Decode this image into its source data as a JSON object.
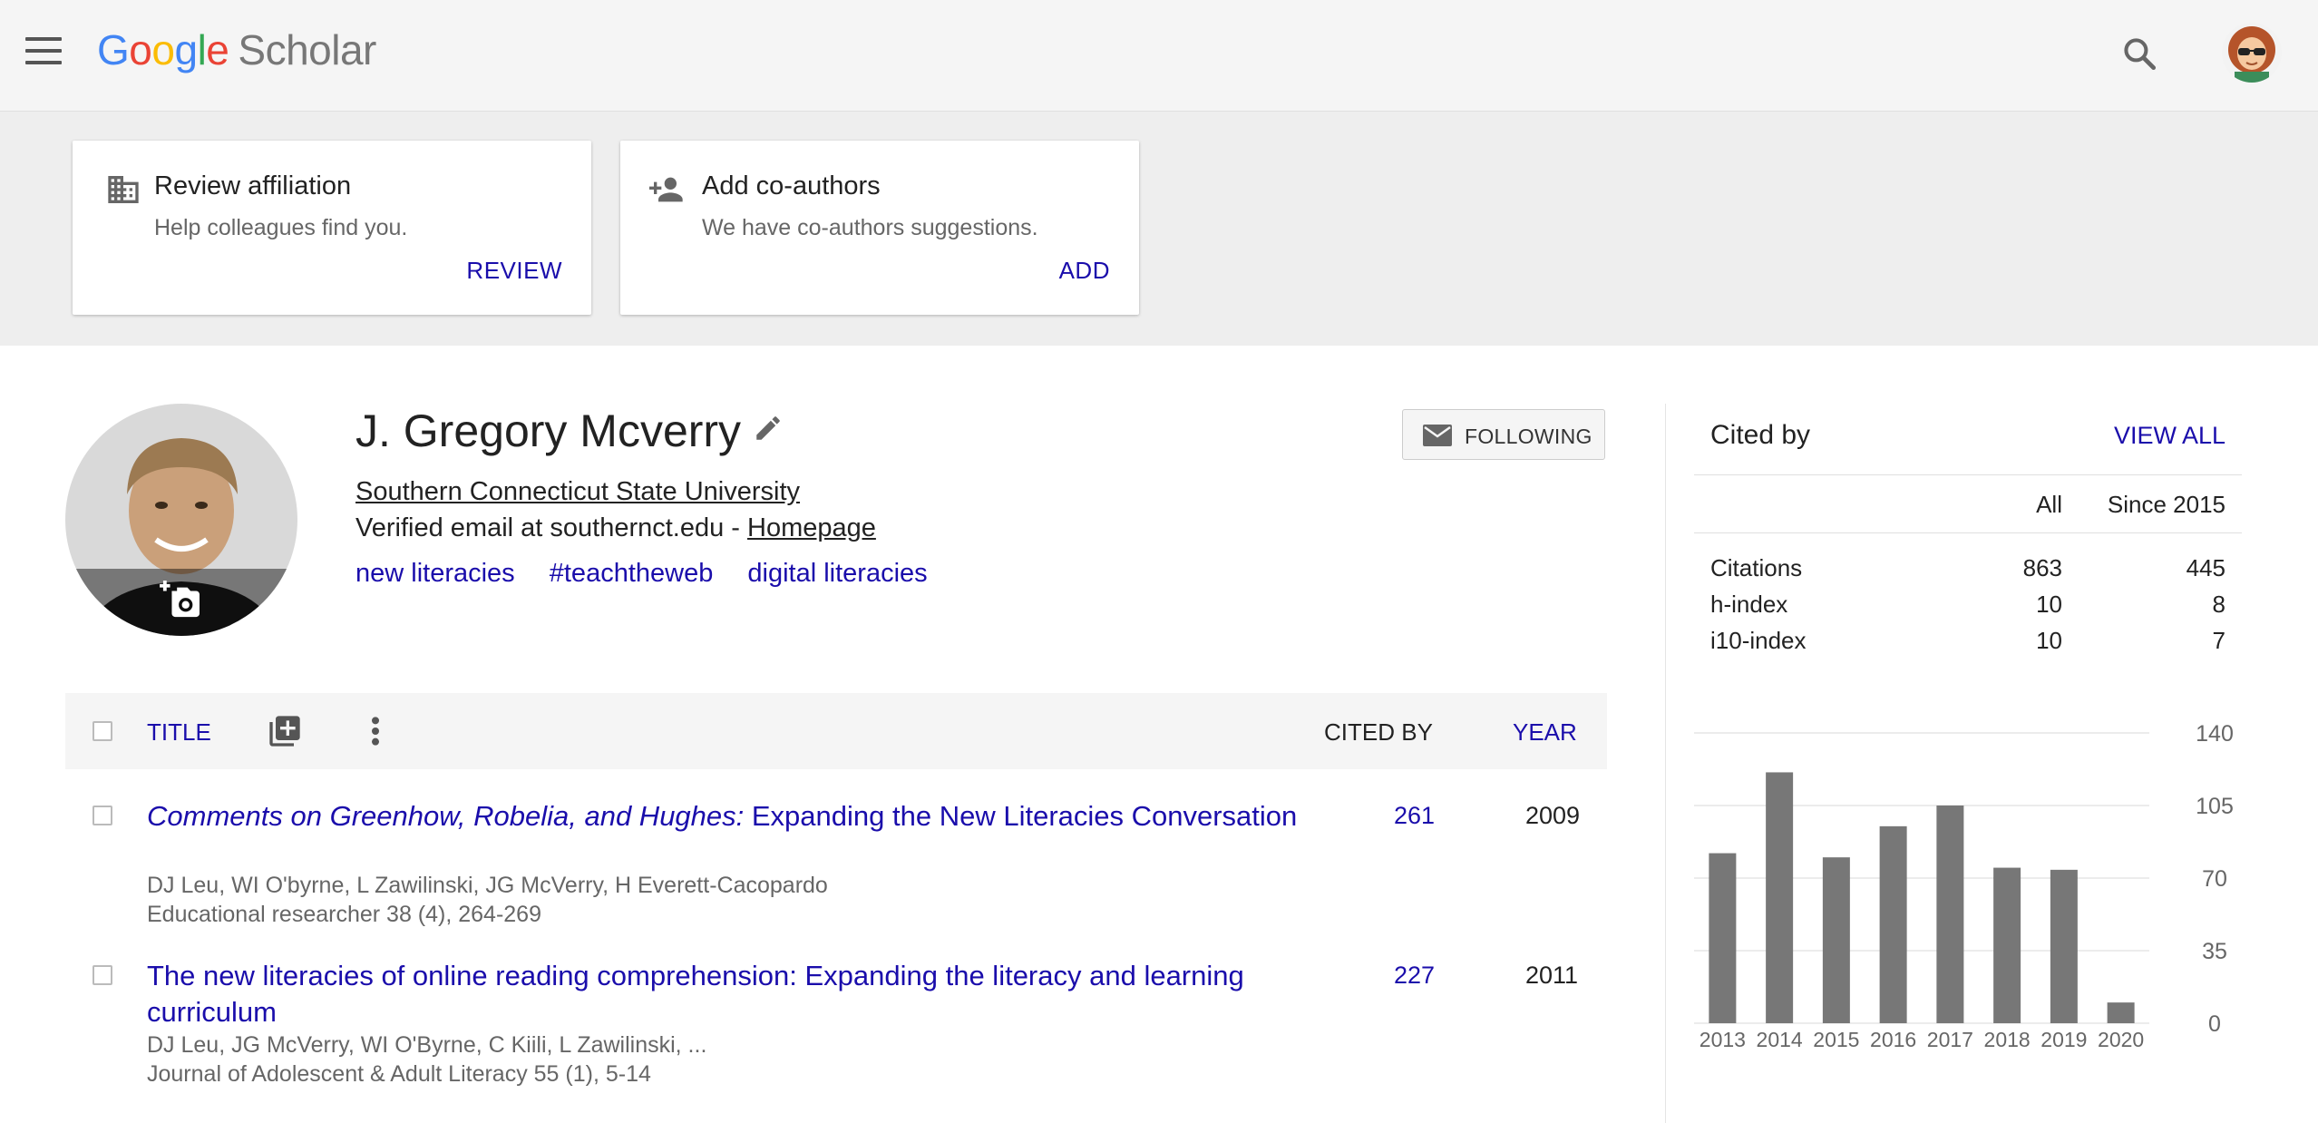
{
  "header": {
    "logo_letters": [
      "G",
      "o",
      "o",
      "g",
      "l",
      "e"
    ],
    "logo_suffix": "Scholar"
  },
  "banner": {
    "cards": [
      {
        "title": "Review affiliation",
        "subtitle": "Help colleagues find you.",
        "action": "REVIEW",
        "icon": "building-icon"
      },
      {
        "title": "Add co-authors",
        "subtitle": "We have co-authors suggestions.",
        "action": "ADD",
        "icon": "add-person-icon"
      }
    ]
  },
  "profile": {
    "name": "J. Gregory Mcverry",
    "affiliation": "Southern Connecticut State University",
    "email_text": "Verified email at southernct.edu - ",
    "homepage_label": "Homepage",
    "interests": [
      "new literacies",
      "#teachtheweb",
      "digital literacies"
    ],
    "follow_label": "FOLLOWING"
  },
  "table": {
    "headers": {
      "title": "TITLE",
      "cited_by": "CITED BY",
      "year": "YEAR"
    },
    "rows": [
      {
        "title_italic": "Comments on Greenhow, Robelia, and Hughes:",
        "title_rest": " Expanding the New Literacies Conversation",
        "authors": "DJ Leu, WI O'byrne, L Zawilinski, JG McVerry, H Everett-Cacopardo",
        "venue": "Educational researcher 38 (4), 264-269",
        "cited_by": "261",
        "year": "2009"
      },
      {
        "title_italic": "",
        "title_rest": "The new literacies of online reading comprehension: Expanding the literacy and learning curriculum",
        "authors": "DJ Leu, JG McVerry, WI O'Byrne, C Kiili, L Zawilinski, ...",
        "venue": "Journal of Adolescent & Adult Literacy 55 (1), 5-14",
        "cited_by": "227",
        "year": "2011"
      }
    ]
  },
  "cited_by": {
    "title": "Cited by",
    "view_all": "VIEW ALL",
    "col_all": "All",
    "col_since": "Since 2015",
    "metrics": [
      {
        "label": "Citations",
        "all": "863",
        "since": "445"
      },
      {
        "label": "h-index",
        "all": "10",
        "since": "8"
      },
      {
        "label": "i10-index",
        "all": "10",
        "since": "7"
      }
    ]
  },
  "colors": {
    "link": "#1a0dab",
    "bar": "#777777",
    "banner_bg": "#eeeeee"
  },
  "chart_data": {
    "type": "bar",
    "categories": [
      "2013",
      "2014",
      "2015",
      "2016",
      "2017",
      "2018",
      "2019",
      "2020"
    ],
    "values": [
      82,
      121,
      80,
      95,
      105,
      75,
      74,
      10
    ],
    "ylim": [
      0,
      140
    ],
    "yticks": [
      0,
      35,
      70,
      105,
      140
    ],
    "grid": true,
    "y_axis_side": "right"
  }
}
